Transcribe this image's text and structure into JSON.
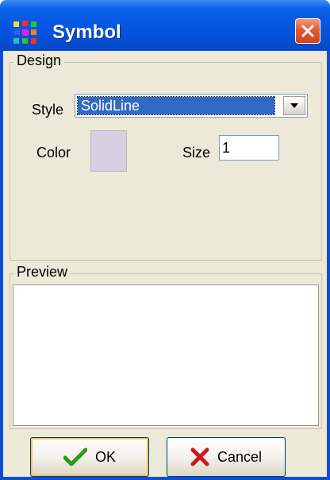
{
  "window": {
    "title": "Symbol",
    "icon": "grid-app-icon",
    "close_icon": "close-icon"
  },
  "design": {
    "legend": "Design",
    "style_label": "Style",
    "style_value": "SolidLine",
    "color_label": "Color",
    "color_value": "#d4d0e0",
    "size_label": "Size",
    "size_value": "1"
  },
  "preview": {
    "legend": "Preview"
  },
  "buttons": {
    "ok_label": "OK",
    "ok_icon": "checkmark-icon",
    "cancel_label": "Cancel",
    "cancel_icon": "x-icon"
  },
  "colors": {
    "titlebar": "#0554e0",
    "face": "#ece9d8",
    "selection": "#316ac5",
    "ok_check": "#2d9a1a",
    "cancel_x": "#cc1a1a"
  }
}
